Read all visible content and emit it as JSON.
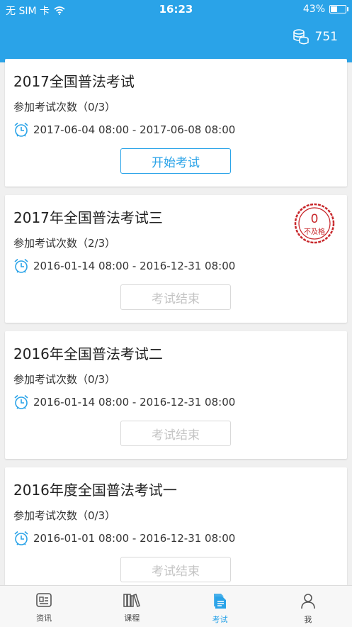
{
  "status_bar": {
    "carrier": "无 SIM 卡",
    "time": "16:23",
    "battery": "43%",
    "battery_level": 0.43
  },
  "header": {
    "coins": "751"
  },
  "exams": [
    {
      "title": "2017全国普法考试",
      "attempts": "参加考试次数（0/3）",
      "time": "2017-06-04 08:00 - 2017-06-08 08:00",
      "button": "开始考试",
      "state": "active"
    },
    {
      "title": "2017年全国普法考试三",
      "attempts": "参加考试次数（2/3）",
      "time": "2016-01-14 08:00 - 2016-12-31 08:00",
      "button": "考试结束",
      "state": "ended",
      "stamp": {
        "score": "0",
        "text": "不及格"
      }
    },
    {
      "title": "2016年全国普法考试二",
      "attempts": "参加考试次数（0/3）",
      "time": "2016-01-14 08:00 - 2016-12-31 08:00",
      "button": "考试结束",
      "state": "ended"
    },
    {
      "title": "2016年度全国普法考试一",
      "attempts": "参加考试次数（0/3）",
      "time": "2016-01-01 08:00 - 2016-12-31 08:00",
      "button": "考试结束",
      "state": "ended"
    }
  ],
  "tabs": [
    {
      "label": "资讯",
      "icon": "news-icon",
      "active": false
    },
    {
      "label": "课程",
      "icon": "books-icon",
      "active": false
    },
    {
      "label": "考试",
      "icon": "exam-document-icon",
      "active": true
    },
    {
      "label": "我",
      "icon": "person-icon",
      "active": false
    }
  ],
  "colors": {
    "accent": "#2aa3e8",
    "stamp": "#c8262a",
    "disabled": "#c4c4c4"
  }
}
